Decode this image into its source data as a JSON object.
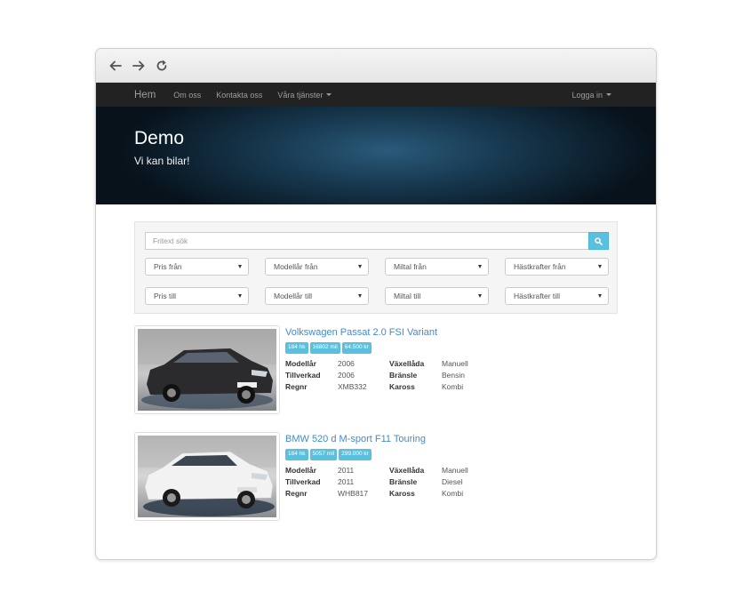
{
  "navbar": {
    "brand": "Hem",
    "links": [
      "Om oss",
      "Kontakta oss",
      "Våra tjänster"
    ],
    "login": "Logga in"
  },
  "hero": {
    "title": "Demo",
    "subtitle": "Vi kan bilar!"
  },
  "search": {
    "placeholder": "Fritext sök",
    "filters_from": [
      "Pris från",
      "Modellår från",
      "Miltal från",
      "Hästkrafter från"
    ],
    "filters_to": [
      "Pris till",
      "Modellår till",
      "Miltal till",
      "Hästkrafter till"
    ]
  },
  "listings": [
    {
      "title": "Volkswagen Passat 2.0 FSI Variant",
      "badges": [
        "184 hk",
        "16802 mil",
        "64.500 kr"
      ],
      "specs": {
        "modellar_label": "Modellår",
        "modellar": "2006",
        "vaxellada_label": "Växellåda",
        "vaxellada": "Manuell",
        "tillverkad_label": "Tillverkad",
        "tillverkad": "2006",
        "bransle_label": "Bränsle",
        "bransle": "Bensin",
        "regnr_label": "Regnr",
        "regnr": "XMB332",
        "kaross_label": "Kaross",
        "kaross": "Kombi"
      },
      "car_color": "#2b2b2e"
    },
    {
      "title": "BMW 520 d M-sport F11 Touring",
      "badges": [
        "184 hk",
        "5057 mil",
        "299.000 kr"
      ],
      "specs": {
        "modellar_label": "Modellår",
        "modellar": "2011",
        "vaxellada_label": "Växellåda",
        "vaxellada": "Manuell",
        "tillverkad_label": "Tillverkad",
        "tillverkad": "2011",
        "bransle_label": "Bränsle",
        "bransle": "Diesel",
        "regnr_label": "Regnr",
        "regnr": "WHB817",
        "kaross_label": "Kaross",
        "kaross": "Kombi"
      },
      "car_color": "#f2f2f2"
    }
  ],
  "icons": {
    "back": "arrow-left-icon",
    "forward": "arrow-right-icon",
    "reload": "reload-icon",
    "search": "search-icon"
  }
}
